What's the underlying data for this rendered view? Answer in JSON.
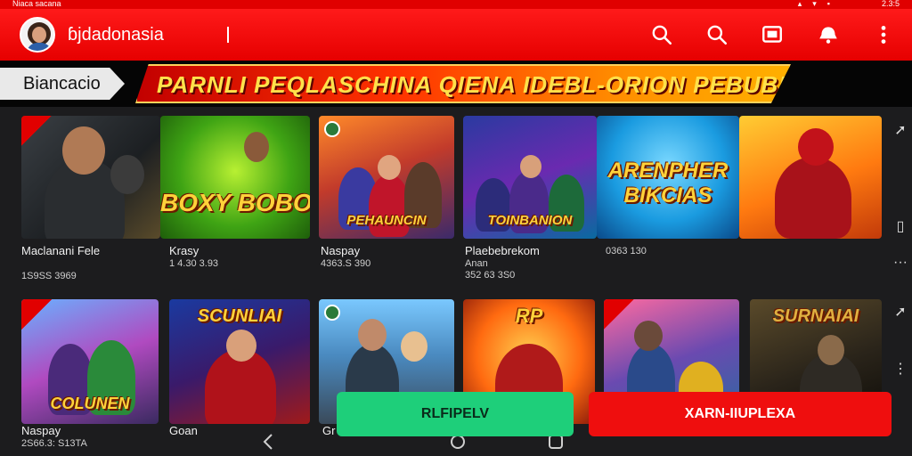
{
  "statusbar": {
    "left_text": "Niaca sacana",
    "right_text": "2.3:5"
  },
  "appbar": {
    "title": "ɓjdadonasia",
    "icons": [
      "search-icon",
      "search-icon",
      "screen-cast-icon",
      "notification-icon",
      "more-vert-icon"
    ]
  },
  "banner": {
    "tab_label": "Biancacio",
    "promo_text": "PARNLI PEQLASCHINA QIENA IDEBL-ORION PEBUBLEM!"
  },
  "colors": {
    "primary_red": "#e60000",
    "accent_green": "#1ecf7a",
    "promo_gold": "#ffd23a"
  },
  "games_row1": [
    {
      "logo": "",
      "caption": "Maclanani Fele",
      "sub": "1S9SS 3969"
    },
    {
      "logo": "BOXY BOBOMIN",
      "caption": "Krasy",
      "sub": "1 4.30 3.93"
    },
    {
      "logo": "PEHAUNCIN",
      "caption": "Naspay",
      "sub": "4363.S 390"
    },
    {
      "logo": "TOINBANION",
      "caption": "Plaebebrekom",
      "sub": "Anan\n352 63 3S0"
    },
    {
      "logo": "ARENPHER BIKCIAS",
      "caption": "",
      "sub": "0363 130"
    },
    {
      "logo": "",
      "caption": "",
      "sub": ""
    }
  ],
  "games_row2": [
    {
      "logo": "COLUNEN",
      "caption": "Naspay",
      "sub": "2S66.3: S13TA"
    },
    {
      "logo": "SCUNLIAI",
      "caption": "Goan",
      "sub": ""
    },
    {
      "logo": "",
      "caption": "Gr",
      "sub": ""
    },
    {
      "logo": "RP",
      "caption": "",
      "sub": ""
    },
    {
      "logo": "",
      "caption": "",
      "sub": ""
    },
    {
      "logo": "SURNAIAI",
      "caption": "",
      "sub": ""
    }
  ],
  "buttons": {
    "primary": "RLFIPELV",
    "secondary": "XARN-IIUPLEXA"
  },
  "nav": {
    "icons": [
      "back-icon",
      "home-icon",
      "recents-icon"
    ]
  }
}
